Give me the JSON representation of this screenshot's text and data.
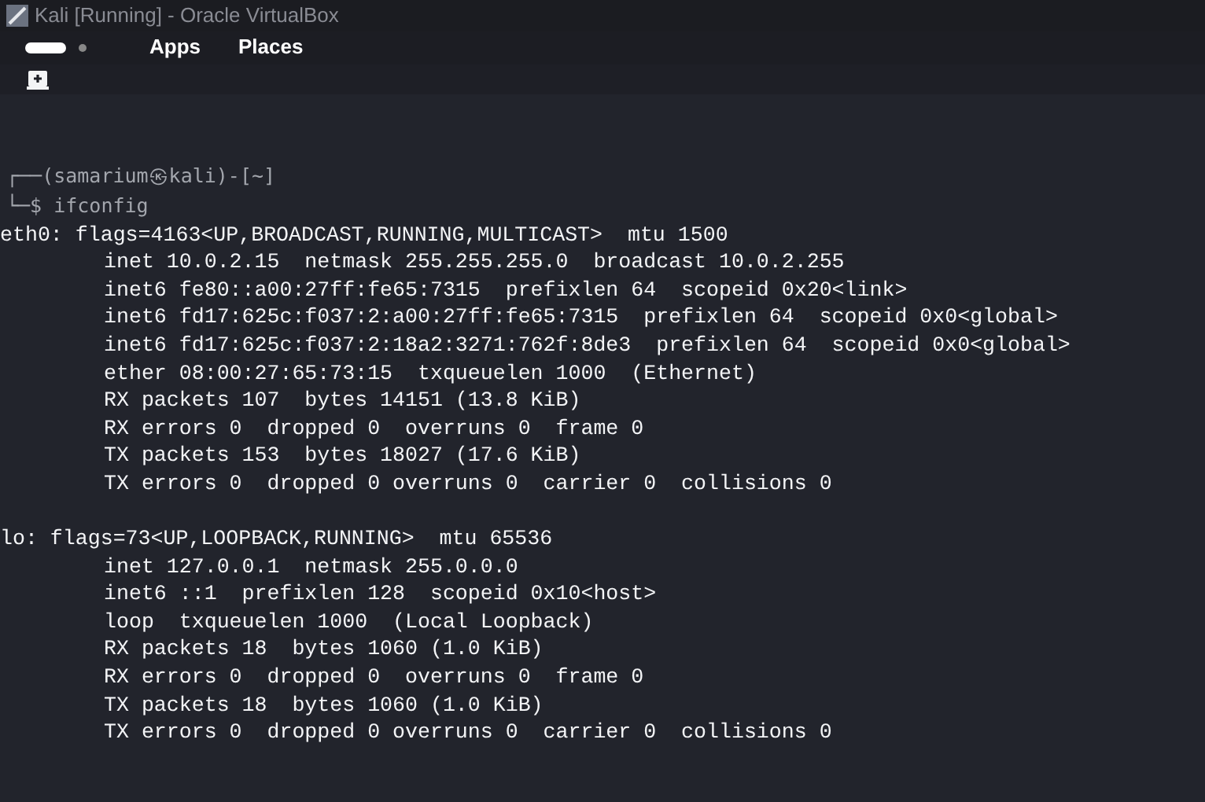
{
  "window": {
    "title": "Kali [Running] - Oracle VirtualBox"
  },
  "top_panel": {
    "menus": [
      "Apps",
      "Places"
    ]
  },
  "terminal": {
    "prompt_lines": [
      "┌──(samarium㉿kali)-[~]",
      "└─$ ifconfig"
    ],
    "interfaces": [
      {
        "header": "eth0: flags=4163<UP,BROADCAST,RUNNING,MULTICAST>  mtu 1500",
        "lines": [
          "inet 10.0.2.15  netmask 255.255.255.0  broadcast 10.0.2.255",
          "inet6 fe80::a00:27ff:fe65:7315  prefixlen 64  scopeid 0x20<link>",
          "inet6 fd17:625c:f037:2:a00:27ff:fe65:7315  prefixlen 64  scopeid 0x0<global>",
          "inet6 fd17:625c:f037:2:18a2:3271:762f:8de3  prefixlen 64  scopeid 0x0<global>",
          "ether 08:00:27:65:73:15  txqueuelen 1000  (Ethernet)",
          "RX packets 107  bytes 14151 (13.8 KiB)",
          "RX errors 0  dropped 0  overruns 0  frame 0",
          "TX packets 153  bytes 18027 (17.6 KiB)",
          "TX errors 0  dropped 0 overruns 0  carrier 0  collisions 0"
        ]
      },
      {
        "header": "lo: flags=73<UP,LOOPBACK,RUNNING>  mtu 65536",
        "lines": [
          "inet 127.0.0.1  netmask 255.0.0.0",
          "inet6 ::1  prefixlen 128  scopeid 0x10<host>",
          "loop  txqueuelen 1000  (Local Loopback)",
          "RX packets 18  bytes 1060 (1.0 KiB)",
          "RX errors 0  dropped 0  overruns 0  frame 0",
          "TX packets 18  bytes 1060 (1.0 KiB)",
          "TX errors 0  dropped 0 overruns 0  carrier 0  collisions 0"
        ]
      }
    ]
  }
}
